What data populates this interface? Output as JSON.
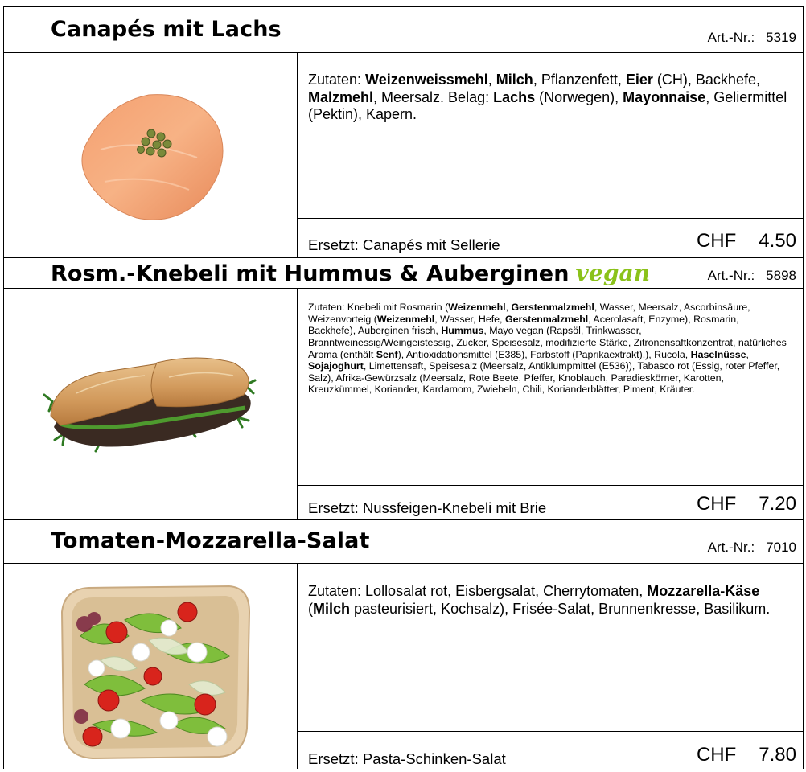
{
  "labels": {
    "zutaten": "Zutaten:",
    "ersetzt": "Ersetzt:",
    "artnr": "Art.-Nr.:",
    "currency": "CHF"
  },
  "products": [
    {
      "title": "Canapés mit Lachs",
      "vegan": "",
      "artnr": "5319",
      "image": "salmon-canape-image",
      "ingredients": [
        {
          "t": "Zutaten: ",
          "b": false
        },
        {
          "t": "Weizenweissmehl",
          "b": true
        },
        {
          "t": ", ",
          "b": false
        },
        {
          "t": "Milch",
          "b": true
        },
        {
          "t": ", Pflanzenfett, ",
          "b": false
        },
        {
          "t": "Eier",
          "b": true
        },
        {
          "t": " (CH), Backhefe, ",
          "b": false
        },
        {
          "t": "Malzmehl",
          "b": true
        },
        {
          "t": ", Meersalz. Belag: ",
          "b": false
        },
        {
          "t": "Lachs",
          "b": true
        },
        {
          "t": " (Norwegen), ",
          "b": false
        },
        {
          "t": "Mayonnaise",
          "b": true
        },
        {
          "t": ", Geliermittel (Pektin), Kapern.",
          "b": false
        }
      ],
      "replaces": "Ersetzt: Canapés mit Sellerie",
      "price": "4.50"
    },
    {
      "title": "Rosm.-Knebeli mit Hummus & Auberginen",
      "vegan": "vegan",
      "artnr": "5898",
      "image": "knebeli-sandwich-image",
      "ingredients": [
        {
          "t": "Zutaten: Knebeli mit Rosmarin (",
          "b": false
        },
        {
          "t": "Weizenmehl",
          "b": true
        },
        {
          "t": ", ",
          "b": false
        },
        {
          "t": "Gerstenmalzmehl",
          "b": true
        },
        {
          "t": ", Wasser, Meersalz, Ascorbinsäure, Weizenvorteig (",
          "b": false
        },
        {
          "t": "Weizenmehl",
          "b": true
        },
        {
          "t": ", Wasser, Hefe, ",
          "b": false
        },
        {
          "t": "Gerstenmalzmehl",
          "b": true
        },
        {
          "t": ", Acerolasaft, Enzyme), Rosmarin, Backhefe), Auberginen frisch, ",
          "b": false
        },
        {
          "t": "Hummus",
          "b": true
        },
        {
          "t": ", Mayo vegan (Rapsöl, Trinkwasser, Branntweinessig/Weingeistessig, Zucker, Speisesalz, modifizierte Stärke, Zitronensaftkonzentrat, natürliches Aroma (enthält ",
          "b": false
        },
        {
          "t": "Senf",
          "b": true
        },
        {
          "t": "), Antioxidationsmittel (E385), Farbstoff (Paprikaextrakt).), Rucola, ",
          "b": false
        },
        {
          "t": "Haselnüsse",
          "b": true
        },
        {
          "t": ", ",
          "b": false
        },
        {
          "t": "Sojajoghurt",
          "b": true
        },
        {
          "t": ", Limettensaft, Speisesalz (Meersalz, Antiklumpmittel (E536)), Tabasco rot (Essig, roter Pfeffer, Salz), Afrika-Gewürzsalz (Meersalz, Rote Beete, Pfeffer, Knoblauch, Paradieskörner, Karotten, Kreuzkümmel, Koriander, Kardamom, Zwiebeln, Chili, Korianderblätter, Piment, Kräuter.",
          "b": false
        }
      ],
      "replaces": "Ersetzt: Nussfeigen-Knebeli mit Brie",
      "price": "7.20"
    },
    {
      "title": "Tomaten-Mozzarella-Salat",
      "vegan": "",
      "artnr": "7010",
      "image": "tomato-mozzarella-salad-image",
      "ingredients": [
        {
          "t": "Zutaten: Lollosalat rot, Eisbergsalat, Cherrytomaten, ",
          "b": false
        },
        {
          "t": "Mozzarella-Käse",
          "b": true
        },
        {
          "t": " (",
          "b": false
        },
        {
          "t": "Milch",
          "b": true
        },
        {
          "t": " pasteurisiert, Kochsalz), Frisée-Salat, Brunnenkresse, Basilikum.",
          "b": false
        }
      ],
      "replaces": "Ersetzt: Pasta-Schinken-Salat",
      "price": "7.80"
    }
  ],
  "colors": {
    "vegan_green": "#8bc21a",
    "border": "#000000"
  }
}
